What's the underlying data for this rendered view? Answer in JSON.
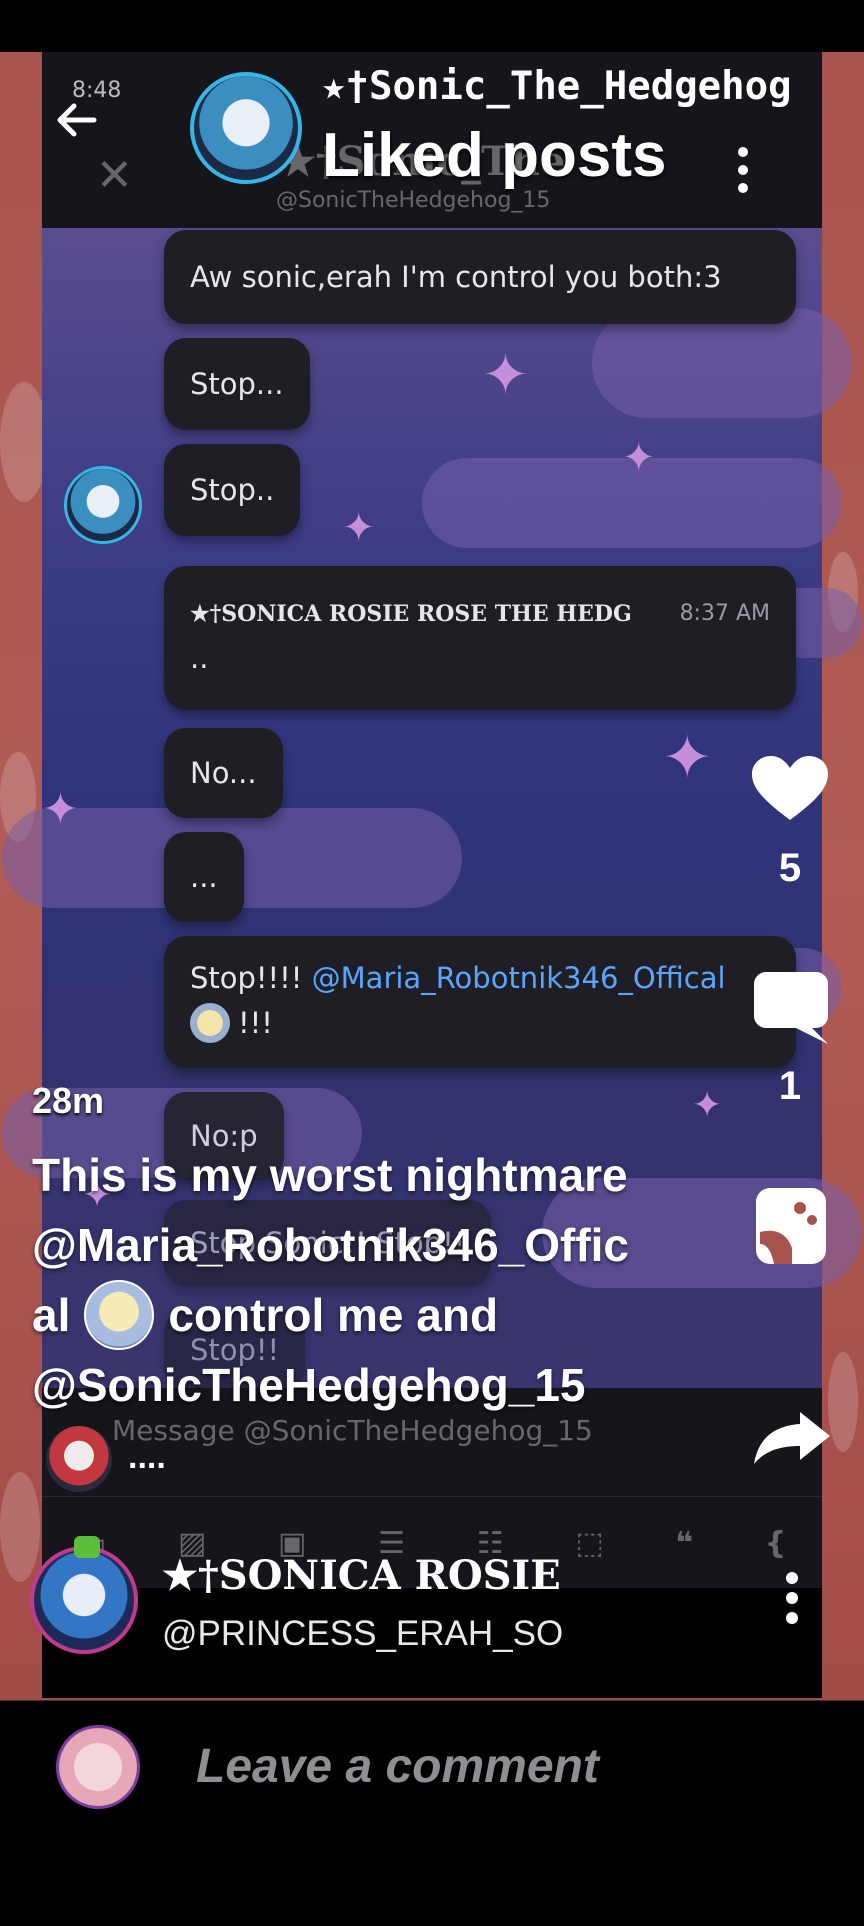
{
  "status_bar": {
    "time": "8:48"
  },
  "header": {
    "title": "Liked posts",
    "poster_name": "★†Sonic_The_Hedgehog",
    "inner_handle": "@SonicTheHedgehog_15",
    "inner_name_ghost": "★†Sonic_The"
  },
  "chat": {
    "partial_top_name": "★ Sonic_The_Hedgehog ★ @Sc   8:37 AM",
    "messages": [
      {
        "text": "Aw sonic,erah I'm control you both:3"
      },
      {
        "text": "Stop..."
      },
      {
        "text": "Stop.."
      },
      {
        "sender": "★†SONICA ROSIE ROSE THE HEDG",
        "time": "8:37 AM",
        "text": ".."
      },
      {
        "text": "No..."
      },
      {
        "text": "..."
      },
      {
        "text_before": "Stop!!!! ",
        "mention": "@Maria_Robotnik346_Offical",
        "text_after": "!!!"
      },
      {
        "text": "No:p"
      },
      {
        "text": "Stop Sonic!! Stop!!"
      },
      {
        "text": "Stop!!"
      }
    ],
    "message_placeholder": "Message @SonicTheHedgehog_15"
  },
  "post": {
    "age": "28m",
    "caption_line1": "This is my worst nightmare",
    "caption_line2": "@Maria_Robotnik346_Offic",
    "caption_line3a": "al",
    "caption_line3b": "control me and",
    "caption_line4": "@SonicTheHedgehog_15",
    "more": "....",
    "author_name": "★†SONICA ROSIE",
    "author_handle": "@PRINCESS_ERAH_SO"
  },
  "actions": {
    "like_count": "5",
    "comment_count": "1"
  },
  "comment_bar": {
    "placeholder": "Leave a comment"
  },
  "colors": {
    "accent_mention": "#5aa5ff",
    "bubble": "#1f1e25",
    "frame": "#a8534e"
  }
}
